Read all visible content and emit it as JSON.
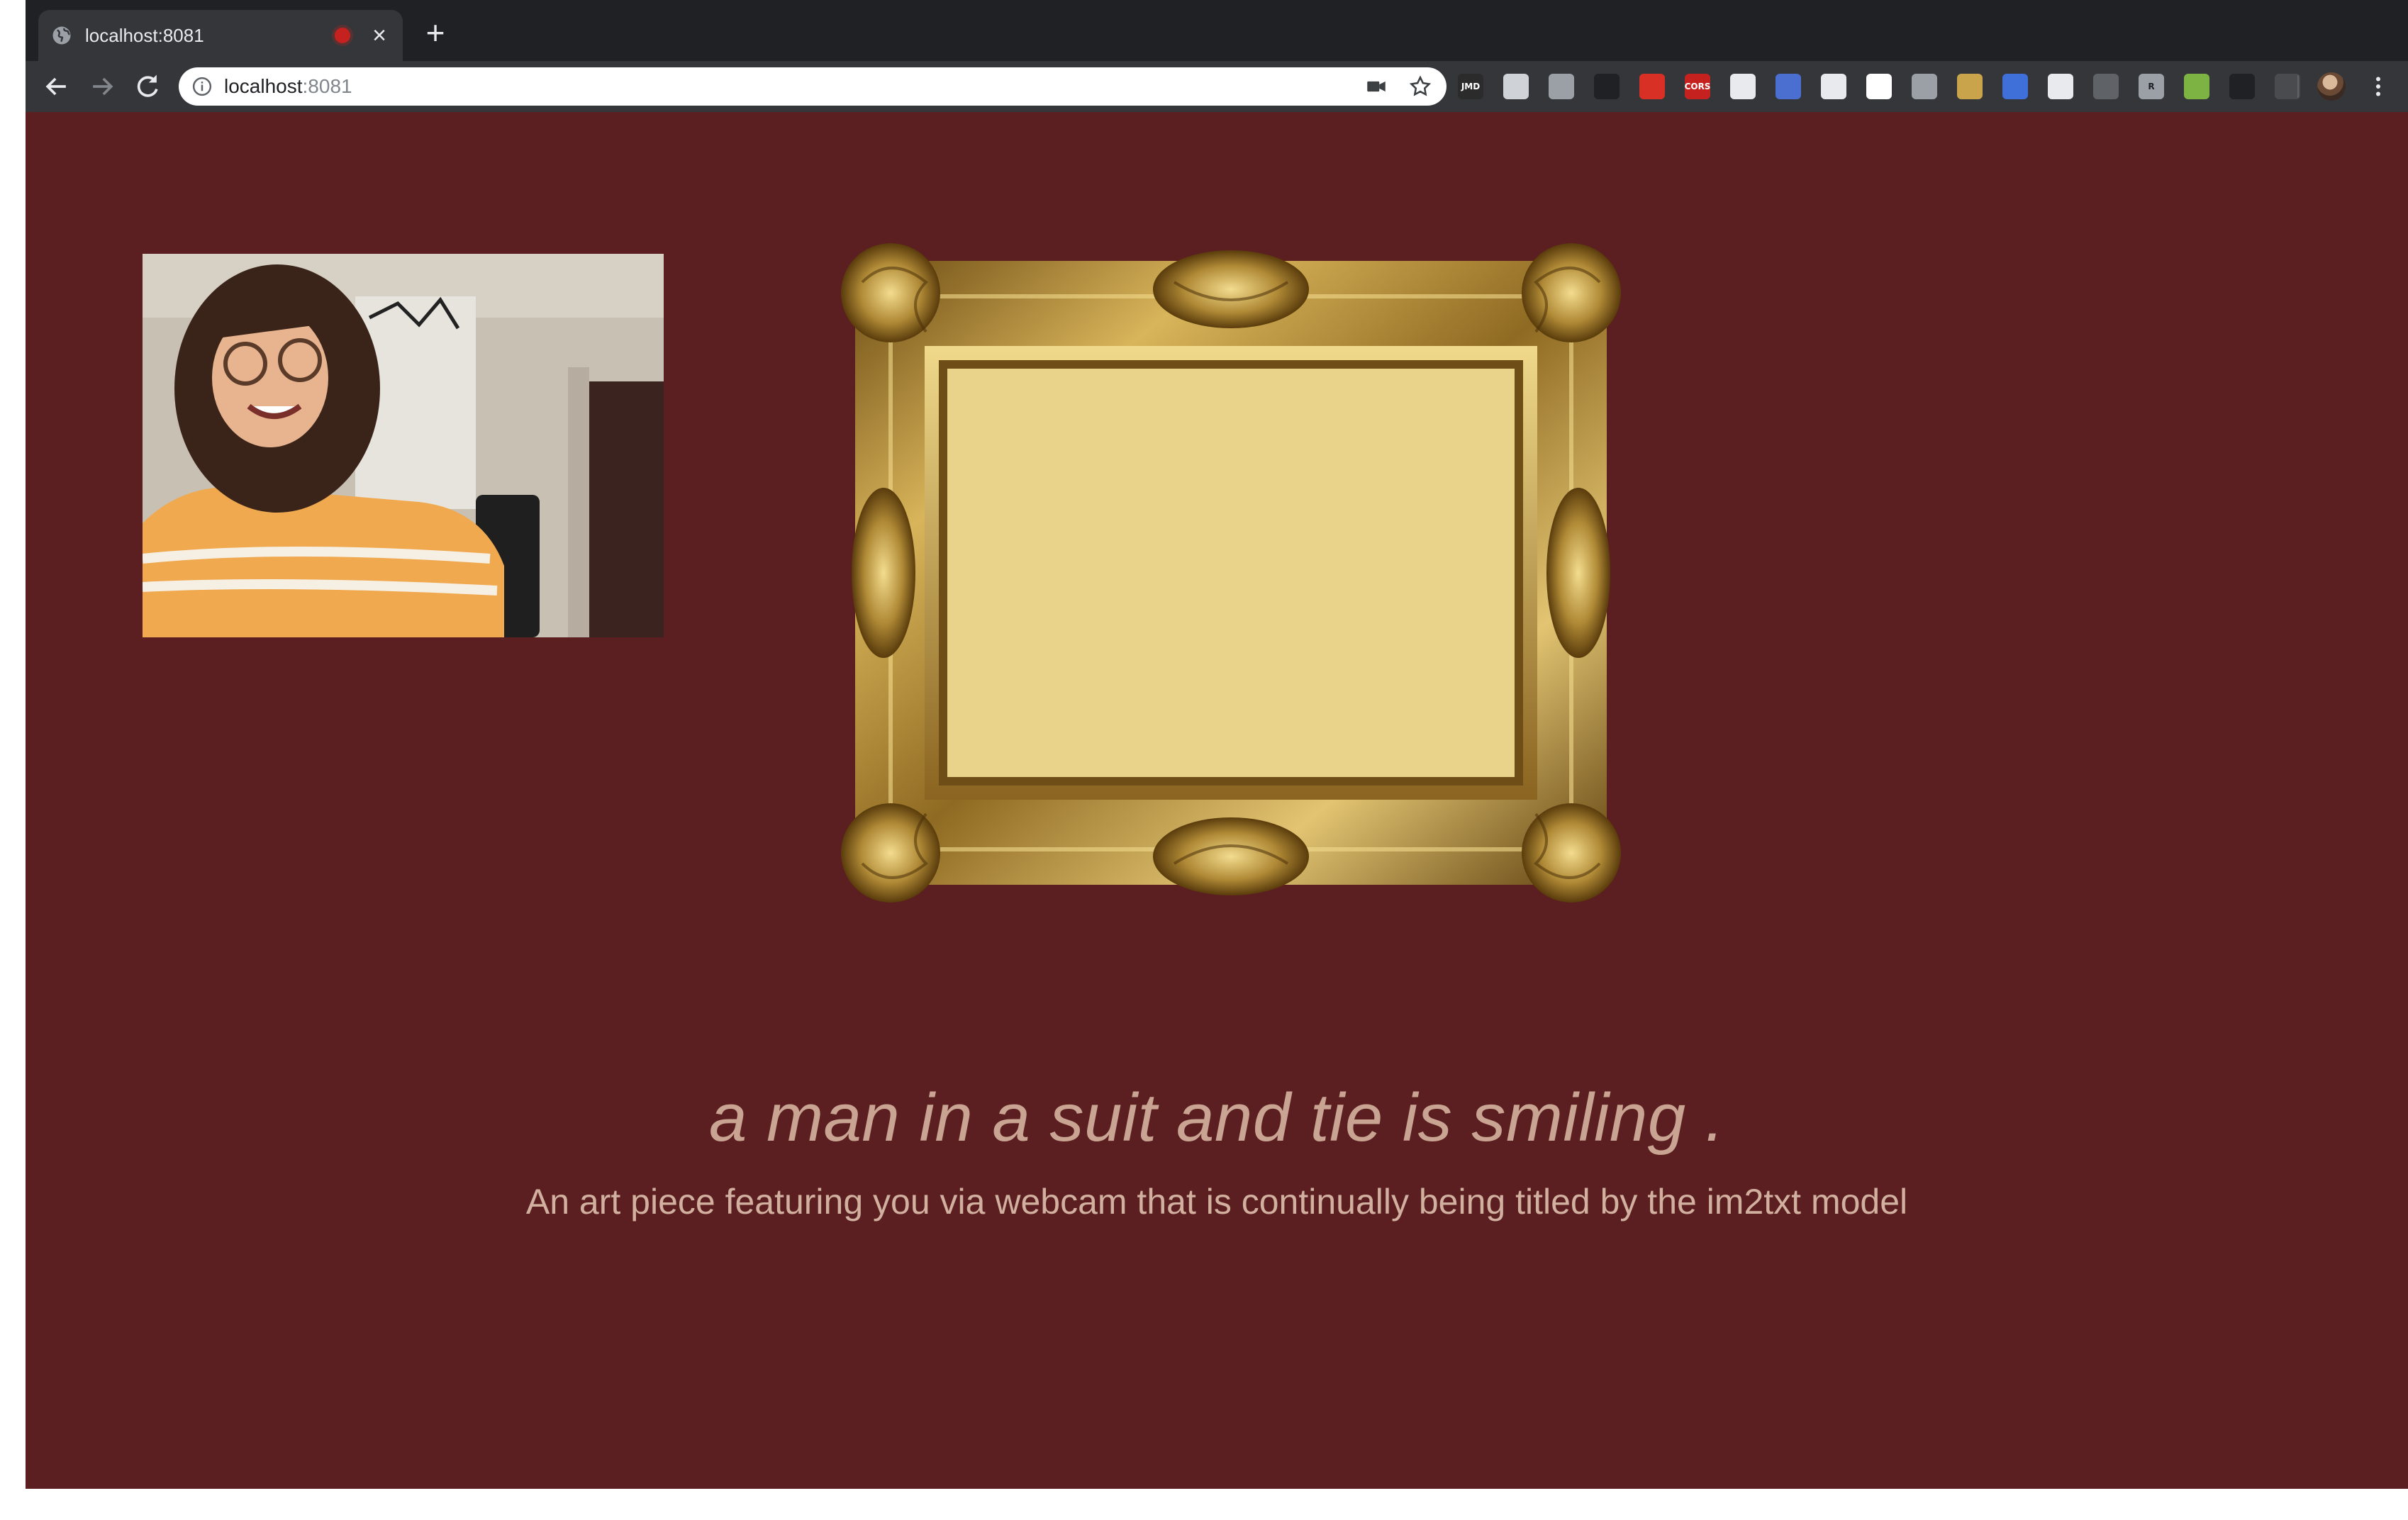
{
  "browser": {
    "tab": {
      "title": "localhost:8081",
      "recording_indicator_color": "#c5221f"
    },
    "new_tab_label": "+",
    "address_bar": {
      "host": "localhost",
      "port": ":8081"
    },
    "extensions": [
      {
        "icon": "extension-dark-icon",
        "text": "JMD",
        "color": "#2b2b2b"
      },
      {
        "icon": "document-icon",
        "text": "",
        "color": "#cfd2d6"
      },
      {
        "icon": "scissors-icon",
        "text": "",
        "color": "#9aa0a6"
      },
      {
        "icon": "flask-icon",
        "text": "",
        "color": "#202124"
      },
      {
        "icon": "stop-hand-icon",
        "text": "",
        "color": "#d93025"
      },
      {
        "icon": "cors-icon",
        "text": "CORS",
        "color": "#c5221f"
      },
      {
        "icon": "close-circle-icon",
        "text": "",
        "color": "#e8eaed"
      },
      {
        "icon": "shield-icon",
        "text": "",
        "color": "#4a6fd1"
      },
      {
        "icon": "card-icon",
        "text": "",
        "color": "#e8eaed"
      },
      {
        "icon": "ghost-icon",
        "text": "",
        "color": "#ffffff"
      },
      {
        "icon": "laptop-icon",
        "text": "",
        "color": "#9aa0a6"
      },
      {
        "icon": "notebook-icon",
        "text": "",
        "color": "#c9a44a"
      },
      {
        "icon": "globe-icon",
        "text": "",
        "color": "#3f6fd8"
      },
      {
        "icon": "trash-icon",
        "text": "",
        "color": "#e8eaed"
      },
      {
        "icon": "grid-icon",
        "text": "",
        "color": "#5f6368"
      },
      {
        "icon": "letter-icon",
        "text": "R",
        "color": "#9aa0a6"
      },
      {
        "icon": "image-icon",
        "text": "",
        "color": "#7cb342"
      },
      {
        "icon": "glasses-icon",
        "text": "",
        "color": "#202124"
      },
      {
        "icon": "faded-icon",
        "text": "",
        "color": "#4a4b4f"
      }
    ]
  },
  "page": {
    "background_color": "#5c1f21",
    "caption": "a man in a suit and tie is smiling .",
    "description": "An art piece featuring you via webcam that is continually being titled by the im2txt model"
  }
}
